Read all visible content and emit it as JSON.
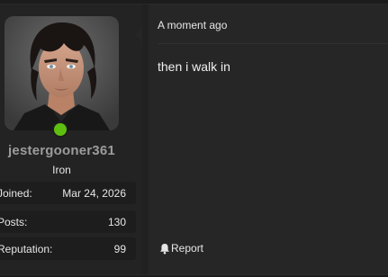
{
  "user": {
    "username": "jestergooner361",
    "title": "Iron",
    "online": true,
    "stats": [
      {
        "label": "Joined:",
        "value": "Mar 24, 2026"
      },
      {
        "label": "Posts:",
        "value": "130"
      },
      {
        "label": "Reputation:",
        "value": "99"
      }
    ]
  },
  "post": {
    "timestamp": "A moment ago",
    "body": "then i walk in",
    "report_label": "Report"
  },
  "colors": {
    "online": "#5fbf10",
    "background": "#1c1c1c",
    "panel": "#262626"
  },
  "icons": {
    "report": "bell-icon",
    "presence": "online-indicator"
  }
}
